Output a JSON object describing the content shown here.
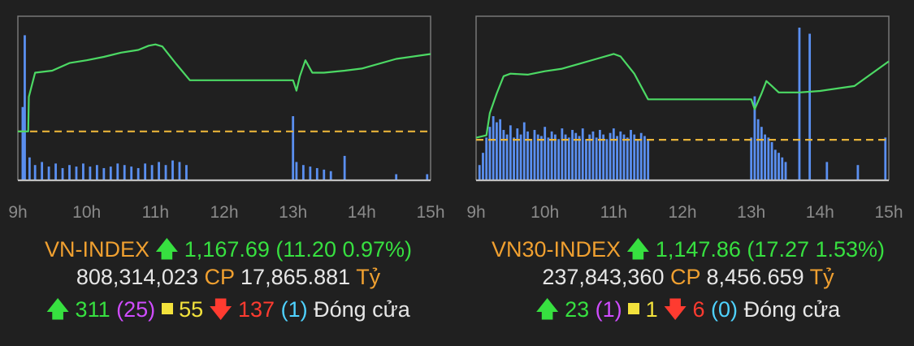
{
  "chart_data": [
    {
      "type": "line",
      "x_ticks": [
        "9h",
        "10h",
        "11h",
        "12h",
        "13h",
        "14h",
        "15h"
      ],
      "reference_level": 1156.49,
      "ylim": [
        1152,
        1172
      ],
      "volume_ylim": [
        0,
        100
      ],
      "series": [
        {
          "values": [
            [
              9.0,
              1156.5
            ],
            [
              9.15,
              1156.5
            ],
            [
              9.16,
              1161.5
            ],
            [
              9.25,
              1165.0
            ],
            [
              9.5,
              1165.3
            ],
            [
              9.75,
              1166.4
            ],
            [
              10.0,
              1166.8
            ],
            [
              10.25,
              1167.3
            ],
            [
              10.5,
              1167.9
            ],
            [
              10.75,
              1168.3
            ],
            [
              10.9,
              1168.9
            ],
            [
              11.0,
              1169.1
            ],
            [
              11.1,
              1168.8
            ],
            [
              11.3,
              1166.3
            ],
            [
              11.5,
              1163.9
            ],
            [
              12.0,
              1163.9
            ],
            [
              13.0,
              1163.9
            ],
            [
              13.05,
              1162.4
            ],
            [
              13.1,
              1164.5
            ],
            [
              13.18,
              1166.8
            ],
            [
              13.28,
              1165.0
            ],
            [
              13.45,
              1165.0
            ],
            [
              13.75,
              1165.3
            ],
            [
              14.0,
              1165.6
            ],
            [
              14.5,
              1167.0
            ],
            [
              15.0,
              1167.7
            ]
          ]
        },
        {
          "type": "bar",
          "values": [
            [
              9.07,
              48
            ],
            [
              9.1,
              95
            ],
            [
              9.17,
              15
            ],
            [
              9.25,
              10
            ],
            [
              9.35,
              12
            ],
            [
              9.45,
              9
            ],
            [
              9.55,
              11
            ],
            [
              9.65,
              8
            ],
            [
              9.75,
              10
            ],
            [
              9.85,
              9
            ],
            [
              9.95,
              11
            ],
            [
              10.05,
              9
            ],
            [
              10.15,
              10
            ],
            [
              10.25,
              8
            ],
            [
              10.35,
              9
            ],
            [
              10.45,
              11
            ],
            [
              10.55,
              10
            ],
            [
              10.65,
              9
            ],
            [
              10.75,
              8
            ],
            [
              10.85,
              11
            ],
            [
              10.95,
              10
            ],
            [
              11.05,
              12
            ],
            [
              11.15,
              10
            ],
            [
              11.25,
              13
            ],
            [
              11.35,
              12
            ],
            [
              11.45,
              10
            ],
            [
              13.0,
              42
            ],
            [
              13.05,
              12
            ],
            [
              13.15,
              10
            ],
            [
              13.25,
              9
            ],
            [
              13.35,
              8
            ],
            [
              13.45,
              7
            ],
            [
              13.55,
              6
            ],
            [
              13.75,
              16
            ],
            [
              14.5,
              4
            ],
            [
              14.95,
              4
            ]
          ]
        }
      ]
    },
    {
      "type": "line",
      "x_ticks": [
        "9h",
        "10h",
        "11h",
        "12h",
        "13h",
        "14h",
        "15h"
      ],
      "reference_level": 1130.59,
      "ylim": [
        1126,
        1154
      ],
      "volume_ylim": [
        0,
        100
      ],
      "series": [
        {
          "values": [
            [
              9.0,
              1131.0
            ],
            [
              9.15,
              1131.5
            ],
            [
              9.2,
              1136.0
            ],
            [
              9.3,
              1140.0
            ],
            [
              9.4,
              1143.5
            ],
            [
              9.5,
              1144.0
            ],
            [
              9.75,
              1143.8
            ],
            [
              10.0,
              1144.5
            ],
            [
              10.25,
              1145.0
            ],
            [
              10.5,
              1146.0
            ],
            [
              10.75,
              1147.0
            ],
            [
              11.0,
              1148.0
            ],
            [
              11.1,
              1147.5
            ],
            [
              11.3,
              1144.0
            ],
            [
              11.5,
              1138.8
            ],
            [
              12.0,
              1138.8
            ],
            [
              13.0,
              1138.8
            ],
            [
              13.05,
              1136.8
            ],
            [
              13.15,
              1140.0
            ],
            [
              13.22,
              1142.5
            ],
            [
              13.3,
              1141.5
            ],
            [
              13.4,
              1140.2
            ],
            [
              13.7,
              1140.2
            ],
            [
              14.0,
              1140.5
            ],
            [
              14.5,
              1141.5
            ],
            [
              15.0,
              1146.5
            ]
          ]
        },
        {
          "type": "bar",
          "values": [
            [
              9.05,
              10
            ],
            [
              9.1,
              18
            ],
            [
              9.15,
              28
            ],
            [
              9.2,
              35
            ],
            [
              9.25,
              42
            ],
            [
              9.3,
              38
            ],
            [
              9.35,
              40
            ],
            [
              9.4,
              33
            ],
            [
              9.45,
              30
            ],
            [
              9.5,
              36
            ],
            [
              9.55,
              28
            ],
            [
              9.6,
              34
            ],
            [
              9.65,
              30
            ],
            [
              9.7,
              38
            ],
            [
              9.75,
              32
            ],
            [
              9.8,
              27
            ],
            [
              9.85,
              33
            ],
            [
              9.9,
              30
            ],
            [
              9.95,
              29
            ],
            [
              10.0,
              35
            ],
            [
              10.05,
              28
            ],
            [
              10.1,
              32
            ],
            [
              10.15,
              30
            ],
            [
              10.2,
              27
            ],
            [
              10.25,
              34
            ],
            [
              10.3,
              30
            ],
            [
              10.35,
              28
            ],
            [
              10.4,
              33
            ],
            [
              10.45,
              31
            ],
            [
              10.5,
              29
            ],
            [
              10.55,
              34
            ],
            [
              10.6,
              27
            ],
            [
              10.65,
              30
            ],
            [
              10.7,
              32
            ],
            [
              10.75,
              28
            ],
            [
              10.8,
              33
            ],
            [
              10.85,
              30
            ],
            [
              10.9,
              27
            ],
            [
              10.95,
              31
            ],
            [
              11.0,
              34
            ],
            [
              11.05,
              29
            ],
            [
              11.1,
              32
            ],
            [
              11.15,
              30
            ],
            [
              11.2,
              28
            ],
            [
              11.25,
              33
            ],
            [
              11.3,
              30
            ],
            [
              11.35,
              27
            ],
            [
              11.4,
              31
            ],
            [
              11.45,
              29
            ],
            [
              11.5,
              26
            ],
            [
              13.0,
              28
            ],
            [
              13.05,
              55
            ],
            [
              13.1,
              40
            ],
            [
              13.15,
              35
            ],
            [
              13.2,
              30
            ],
            [
              13.25,
              28
            ],
            [
              13.3,
              25
            ],
            [
              13.35,
              20
            ],
            [
              13.4,
              18
            ],
            [
              13.45,
              15
            ],
            [
              13.5,
              12
            ],
            [
              13.7,
              100
            ],
            [
              13.85,
              96
            ],
            [
              14.1,
              12
            ],
            [
              14.55,
              10
            ],
            [
              14.95,
              28
            ]
          ]
        }
      ]
    }
  ],
  "left": {
    "name": "VN-INDEX",
    "value": "1,167.69",
    "change": "(11.20 0.97%)",
    "volume": "808,314,023",
    "cp_label": "CP",
    "turnover": "17,865.881",
    "unit": "Tỷ",
    "advances": "311",
    "ceiling": "(25)",
    "unchanged": "55",
    "declines": "137",
    "floor": "(1)",
    "status": "Đóng cửa"
  },
  "right": {
    "name": "VN30-INDEX",
    "value": "1,147.86",
    "change": "(17.27 1.53%)",
    "volume": "237,843,360",
    "cp_label": "CP",
    "turnover": "8,456.659",
    "unit": "Tỷ",
    "advances": "23",
    "ceiling": "(1)",
    "unchanged": "1",
    "declines": "6",
    "floor": "(0)",
    "status": "Đóng cửa"
  },
  "colors": {
    "line": "#4cd964",
    "reference": "#e8b339",
    "volume": "#5a8ff0",
    "axis": "#c0c0c0",
    "tick_label": "#8a8a8a",
    "frame": "#777777"
  }
}
